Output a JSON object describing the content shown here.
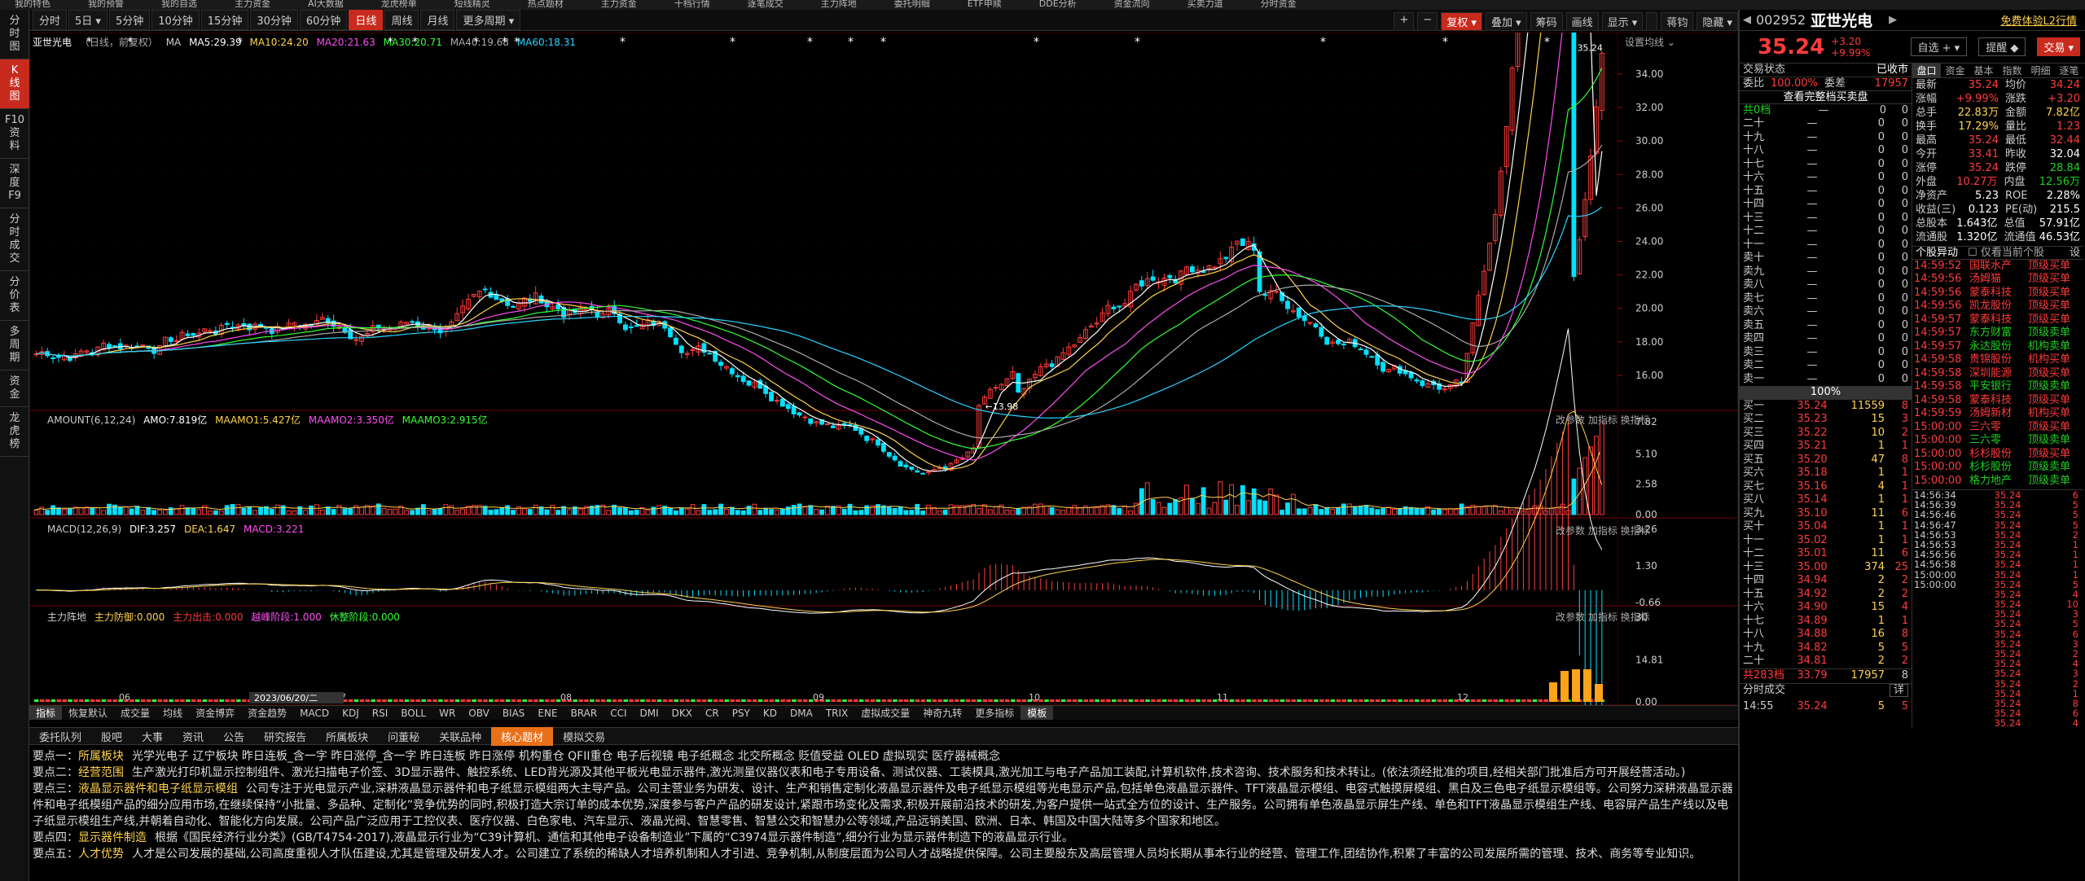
{
  "top_menu": [
    "我的特色",
    "我的预警",
    "我的自选",
    "主力资金",
    "AI大数据",
    "龙虎榜单",
    "短线精灵",
    "热点题材",
    "主力资金",
    "十档行情",
    "逐笔成交",
    "主力阵地",
    "委托明细",
    "ETF申赎",
    "DDE分析",
    "资金流向",
    "买卖力道",
    "分时资金"
  ],
  "left_tabs": [
    {
      "label": "分\n时\n图",
      "active": false
    },
    {
      "label": "K\n线\n图",
      "active": true
    },
    {
      "label": "F10\n资\n料",
      "active": false
    },
    {
      "label": "深\n度\nF9",
      "active": false
    },
    {
      "label": "分\n时\n成\n交",
      "active": false
    },
    {
      "label": "分\n价\n表",
      "active": false
    },
    {
      "label": "多\n周\n期",
      "active": false
    },
    {
      "label": "资\n金",
      "active": false
    },
    {
      "label": "龙\n虎\n榜",
      "active": false
    }
  ],
  "periods": [
    {
      "label": "分时",
      "active": false
    },
    {
      "label": "5日 ▾",
      "active": false
    },
    {
      "label": "5分钟",
      "active": false
    },
    {
      "label": "10分钟",
      "active": false
    },
    {
      "label": "15分钟",
      "active": false
    },
    {
      "label": "30分钟",
      "active": false
    },
    {
      "label": "60分钟",
      "active": false
    },
    {
      "label": "日线",
      "active": true
    },
    {
      "label": "周线",
      "active": false
    },
    {
      "label": "月线",
      "active": false
    },
    {
      "label": "更多周期 ▾",
      "active": false
    }
  ],
  "right_tools": [
    {
      "label": "+",
      "red": false
    },
    {
      "label": "−",
      "red": false
    },
    {
      "label": "复权 ▾",
      "red": true
    },
    {
      "label": "叠加 ▾",
      "red": false
    },
    {
      "label": "筹码",
      "red": false
    },
    {
      "label": "画线",
      "red": false
    },
    {
      "label": "显示 ▾",
      "red": false
    },
    {
      "label": "",
      "red": false
    },
    {
      "label": "蒋钧",
      "red": false
    },
    {
      "label": "隐藏 ▾",
      "red": false
    }
  ],
  "ma_header": {
    "name": "亚世光电",
    "sub": "（日线，前复权）",
    "ma": "MA",
    "ma5": "MA5:29.39",
    "ma10": "MA10:24.20",
    "ma20": "MA20:21.63",
    "ma30": "MA30:20.71",
    "ma40": "MA40:19.68",
    "ma60": "MA60:18.31",
    "right": "设置均线 ⌄"
  },
  "amount_header": {
    "name": "AMOUNT(6,12,24)",
    "amo": "AMO:7.819亿",
    "a1": "MAAMO1:5.427亿",
    "a2": "MAAMO2:3.350亿",
    "a3": "MAAMO3:2.915亿",
    "right": "改参数  加指标  换指标"
  },
  "macd_header": {
    "name": "MACD(12,26,9)",
    "dif": "DIF:3.257",
    "dea": "DEA:1.647",
    "macd": "MACD:3.221",
    "right": "改参数  加指标  换指标"
  },
  "zl_header": {
    "name": "主力阵地",
    "a": "主力防御:0.000",
    "b": "主力出击:0.000",
    "c": "越峰阶段:1.000",
    "d": "休整阶段:0.000",
    "right": "改参数  加指标  换指标"
  },
  "chart_data": {
    "type": "candlestick",
    "price_ticks": [
      "34.00",
      "32.00",
      "30.00",
      "28.00",
      "26.00",
      "24.00",
      "22.00",
      "20.00",
      "18.00",
      "16.00"
    ],
    "price_range": [
      14.2,
      35.6
    ],
    "latest_close_label": "35.24",
    "low_label": "13.98",
    "amount_ticks": [
      "7.82",
      "5.10",
      "2.58",
      "0.00"
    ],
    "macd_ticks": [
      "3.26",
      "1.30",
      "-0.66"
    ],
    "zl_ticks": [
      "30",
      "14.81",
      "0.00"
    ],
    "month_labels": [
      "06",
      "07",
      "08",
      "09",
      "10",
      "11",
      "12"
    ],
    "date_label": "2023/06/20/二"
  },
  "indicator_tabs": [
    {
      "label": "指标",
      "active": true
    },
    {
      "label": "恢复默认",
      "active": false
    },
    {
      "label": "成交量",
      "active": false
    },
    {
      "label": "均线",
      "active": false
    },
    {
      "label": "资金博弈",
      "active": false
    },
    {
      "label": "资金趋势",
      "active": false
    },
    {
      "label": "MACD",
      "active": false
    },
    {
      "label": "KDJ",
      "active": false
    },
    {
      "label": "RSI",
      "active": false
    },
    {
      "label": "BOLL",
      "active": false
    },
    {
      "label": "WR",
      "active": false
    },
    {
      "label": "OBV",
      "active": false
    },
    {
      "label": "BIAS",
      "active": false
    },
    {
      "label": "ENE",
      "active": false
    },
    {
      "label": "BRAR",
      "active": false
    },
    {
      "label": "CCI",
      "active": false
    },
    {
      "label": "DMI",
      "active": false
    },
    {
      "label": "DKX",
      "active": false
    },
    {
      "label": "CR",
      "active": false
    },
    {
      "label": "PSY",
      "active": false
    },
    {
      "label": "KD",
      "active": false
    },
    {
      "label": "DMA",
      "active": false
    },
    {
      "label": "TRIX",
      "active": false
    },
    {
      "label": "虚拟成交量",
      "active": false
    },
    {
      "label": "神奇九转",
      "active": false
    },
    {
      "label": "更多指标",
      "active": false
    },
    {
      "label": "模板",
      "active": true
    }
  ],
  "bottom_tabs": [
    {
      "label": "委托队列",
      "active": false
    },
    {
      "label": "股吧",
      "active": false
    },
    {
      "label": "大事",
      "active": false
    },
    {
      "label": "资讯",
      "active": false
    },
    {
      "label": "公告",
      "active": false
    },
    {
      "label": "研究报告",
      "active": false
    },
    {
      "label": "所属板块",
      "active": false
    },
    {
      "label": "问董秘",
      "active": false
    },
    {
      "label": "关联品种",
      "active": false
    },
    {
      "label": "核心题材",
      "active": true
    },
    {
      "label": "模拟交易",
      "active": false
    }
  ],
  "info_lines": [
    {
      "k": "要点一：",
      "v": "所属板块",
      "t": "光学光电子 辽宁板块 昨日连板_含一字 昨日涨停_含一字 昨日连板 昨日涨停 机构重仓 QFII重仓 电子后视镜 电子纸概念 北交所概念 贬值受益 OLED 虚拟现实 医疗器械概念"
    },
    {
      "k": "要点二：",
      "v": "经营范围",
      "t": "生产激光打印机显示控制组件、激光扫描电子价签、3D显示器件、触控系统、LED背光源及其他平板光电显示器件,激光测量仪器仪表和电子专用设备、测试仪器、工装模具,激光加工与电子产品加工装配,计算机软件,技术咨询、技术服务和技术转让。(依法须经批准的项目,经相关部门批准后方可开展经营活动。)"
    },
    {
      "k": "要点三：",
      "v": "液晶显示器件和电子纸显示模组",
      "t": "公司专注于光电显示产业,深耕液晶显示器件和电子纸显示模组两大主导产品。公司主营业务为研发、设计、生产和销售定制化液晶显示器件及电子纸显示模组等光电显示产品,包括单色液晶显示器件、TFT液晶显示模组、电容式触摸屏模组、黑白及三色电子纸显示模组等。公司努力深耕液晶显示器件和电子纸模组产品的细分应用市场,在继续保持“小批量、多品种、定制化”竞争优势的同时,积极打造大宗订单的成本优势,深度参与客户产品的研发设计,紧跟市场变化及需求,积极开展前沿技术的研发,为客户提供一站式全方位的设计、生产服务。公司拥有单色液晶显示屏生产线、单色和TFT液晶显示模组生产线、电容屏产品生产线以及电子纸显示模组生产线,并朝着自动化、智能化方向发展。公司产品广泛应用于工控仪表、医疗仪器、白色家电、汽车显示、液晶光阀、智慧零售、智慧公交和智慧办公等领域,产品远销美国、欧洲、日本、韩国及中国大陆等多个国家和地区。"
    },
    {
      "k": "要点四：",
      "v": "显示器件制造",
      "t": "根据《国民经济行业分类》(GB/T4754-2017),液晶显示行业为“C39计算机、通信和其他电子设备制造业”下属的“C3974显示器件制造”,细分行业为显示器件制造下的液晶显示行业。"
    },
    {
      "k": "要点五：",
      "v": "人才优势",
      "t": "人才是公司发展的基础,公司高度重视人才队伍建设,尤其是管理及研发人才。公司建立了系统的稀缺人才培养机制和人才引进、竞争机制,从制度层面为公司人才战略提供保障。公司主要股东及高层管理人员均长期从事本行业的经营、管理工作,团结协作,积累了丰富的公司发展所需的管理、技术、商务等专业知识。"
    }
  ],
  "quote": {
    "code": "002952",
    "name": "亚世光电",
    "bonus": "免费体验L2行情",
    "price": "35.24",
    "change": "+3.20",
    "pct": "+9.99%",
    "btn_watch": "自选 + ▾",
    "btn_alert": "提醒 ◆",
    "btn_trade": "交易 ▾",
    "status_label": "交易状态",
    "status": "已收市",
    "wb_label": "委比",
    "wb": "100.00%",
    "wc_label": "委差",
    "wc": "17957",
    "full_btn": "查看完整档买卖盘",
    "depth_header": {
      "label": "共0档",
      "a": "—",
      "b": "0",
      "c": "0"
    },
    "sells": [
      {
        "l": "二十",
        "p": "—",
        "v": "0",
        "n": "0"
      },
      {
        "l": "十九",
        "p": "—",
        "v": "0",
        "n": "0"
      },
      {
        "l": "十八",
        "p": "—",
        "v": "0",
        "n": "0"
      },
      {
        "l": "十七",
        "p": "—",
        "v": "0",
        "n": "0"
      },
      {
        "l": "十六",
        "p": "—",
        "v": "0",
        "n": "0"
      },
      {
        "l": "十五",
        "p": "—",
        "v": "0",
        "n": "0"
      },
      {
        "l": "十四",
        "p": "—",
        "v": "0",
        "n": "0"
      },
      {
        "l": "十三",
        "p": "—",
        "v": "0",
        "n": "0"
      },
      {
        "l": "十二",
        "p": "—",
        "v": "0",
        "n": "0"
      },
      {
        "l": "十一",
        "p": "—",
        "v": "0",
        "n": "0"
      },
      {
        "l": "卖十",
        "p": "—",
        "v": "0",
        "n": "0"
      },
      {
        "l": "卖九",
        "p": "—",
        "v": "0",
        "n": "0"
      },
      {
        "l": "卖八",
        "p": "—",
        "v": "0",
        "n": "0"
      },
      {
        "l": "卖七",
        "p": "—",
        "v": "0",
        "n": "0"
      },
      {
        "l": "卖六",
        "p": "—",
        "v": "0",
        "n": "0"
      },
      {
        "l": "卖五",
        "p": "—",
        "v": "0",
        "n": "0"
      },
      {
        "l": "卖四",
        "p": "—",
        "v": "0",
        "n": "0"
      },
      {
        "l": "卖三",
        "p": "—",
        "v": "0",
        "n": "0"
      },
      {
        "l": "卖二",
        "p": "—",
        "v": "0",
        "n": "0"
      },
      {
        "l": "卖一",
        "p": "—",
        "v": "0",
        "n": "0"
      }
    ],
    "mid_pct": "100%",
    "buys": [
      {
        "l": "买一",
        "p": "35.24",
        "v": "11559",
        "n": "8"
      },
      {
        "l": "买二",
        "p": "35.23",
        "v": "15",
        "n": "3"
      },
      {
        "l": "买三",
        "p": "35.22",
        "v": "10",
        "n": "2"
      },
      {
        "l": "买四",
        "p": "35.21",
        "v": "1",
        "n": "1"
      },
      {
        "l": "买五",
        "p": "35.20",
        "v": "47",
        "n": "8"
      },
      {
        "l": "买六",
        "p": "35.18",
        "v": "1",
        "n": "1"
      },
      {
        "l": "买七",
        "p": "35.16",
        "v": "4",
        "n": "1"
      },
      {
        "l": "买八",
        "p": "35.14",
        "v": "1",
        "n": "1"
      },
      {
        "l": "买九",
        "p": "35.10",
        "v": "11",
        "n": "6"
      },
      {
        "l": "买十",
        "p": "35.04",
        "v": "1",
        "n": "1"
      },
      {
        "l": "十一",
        "p": "35.02",
        "v": "1",
        "n": "1"
      },
      {
        "l": "十二",
        "p": "35.01",
        "v": "11",
        "n": "6"
      },
      {
        "l": "十三",
        "p": "35.00",
        "v": "374",
        "n": "25"
      },
      {
        "l": "十四",
        "p": "34.94",
        "v": "2",
        "n": "2"
      },
      {
        "l": "十五",
        "p": "34.92",
        "v": "2",
        "n": "2"
      },
      {
        "l": "十六",
        "p": "34.90",
        "v": "15",
        "n": "4"
      },
      {
        "l": "十七",
        "p": "34.89",
        "v": "1",
        "n": "1"
      },
      {
        "l": "十八",
        "p": "34.88",
        "v": "16",
        "n": "8"
      },
      {
        "l": "十九",
        "p": "34.82",
        "v": "5",
        "n": "5"
      },
      {
        "l": "二十",
        "p": "34.81",
        "v": "2",
        "n": "2"
      }
    ],
    "buy_total": {
      "label": "共283档",
      "p": "33.79",
      "v": "17957",
      "n": "8"
    },
    "fsc_label": "分时成交",
    "fsc_btn": "详",
    "fsc_last": {
      "t": "14:55",
      "p": "35.24",
      "v": "5",
      "n": "5"
    }
  },
  "stats_tabs": [
    {
      "label": "盘口",
      "active": true
    },
    {
      "label": "资金",
      "active": false
    },
    {
      "label": "基本",
      "active": false
    },
    {
      "label": "指数",
      "active": false
    },
    {
      "label": "明细",
      "active": false
    },
    {
      "label": "逐笔",
      "active": false
    }
  ],
  "stats": [
    {
      "a": "最新",
      "av": "35.24",
      "ac": "red",
      "b": "均价",
      "bv": "34.24",
      "bc": "red"
    },
    {
      "a": "涨幅",
      "av": "+9.99%",
      "ac": "red",
      "b": "涨跌",
      "bv": "+3.20",
      "bc": "red"
    },
    {
      "a": "总手",
      "av": "22.83万",
      "ac": "yel",
      "b": "金额",
      "bv": "7.82亿",
      "bc": "yel"
    },
    {
      "a": "换手",
      "av": "17.29%",
      "ac": "yel",
      "b": "量比",
      "bv": "1.23",
      "bc": "red"
    },
    {
      "a": "最高",
      "av": "35.24",
      "ac": "red",
      "b": "最低",
      "bv": "32.44",
      "bc": "red"
    },
    {
      "a": "今开",
      "av": "33.41",
      "ac": "red",
      "b": "昨收",
      "bv": "32.04",
      "bc": "wht"
    },
    {
      "a": "涨停",
      "av": "35.24",
      "ac": "red",
      "b": "跌停",
      "bv": "28.84",
      "bc": "grn"
    },
    {
      "a": "外盘",
      "av": "10.27万",
      "ac": "red",
      "b": "内盘",
      "bv": "12.56万",
      "bc": "grn"
    },
    {
      "a": "净资产",
      "av": "5.23",
      "ac": "wht",
      "b": "ROE",
      "bv": "2.28%",
      "bc": "wht"
    },
    {
      "a": "收益(三)",
      "av": "0.123",
      "ac": "wht",
      "b": "PE(动)",
      "bv": "215.5",
      "bc": "wht"
    },
    {
      "a": "总股本",
      "av": "1.643亿",
      "ac": "wht",
      "b": "总值",
      "bv": "57.91亿",
      "bc": "wht"
    },
    {
      "a": "流通股",
      "av": "1.320亿",
      "ac": "wht",
      "b": "流通值",
      "bv": "46.53亿",
      "bc": "wht"
    }
  ],
  "yd_header": {
    "title": "个股异动",
    "check": "仅看当前个股",
    "btn": "设"
  },
  "movers": [
    {
      "t": "14:59:52",
      "n": "国联水产",
      "e": "顶级买单",
      "c": "red"
    },
    {
      "t": "14:59:56",
      "n": "汤姆猫",
      "e": "顶级买单",
      "c": "red"
    },
    {
      "t": "14:59:56",
      "n": "蒙泰科技",
      "e": "顶级买单",
      "c": "red"
    },
    {
      "t": "14:59:56",
      "n": "凯龙股份",
      "e": "顶级买单",
      "c": "red"
    },
    {
      "t": "14:59:57",
      "n": "蒙泰科技",
      "e": "顶级买单",
      "c": "red"
    },
    {
      "t": "14:59:57",
      "n": "东方财富",
      "e": "顶级卖单",
      "c": "grn"
    },
    {
      "t": "14:59:57",
      "n": "永达股份",
      "e": "机构卖单",
      "c": "grn"
    },
    {
      "t": "14:59:58",
      "n": "贵锦股份",
      "e": "机构买单",
      "c": "red"
    },
    {
      "t": "14:59:58",
      "n": "深圳能源",
      "e": "顶级买单",
      "c": "red"
    },
    {
      "t": "14:59:58",
      "n": "平安银行",
      "e": "顶级卖单",
      "c": "grn"
    },
    {
      "t": "14:59:58",
      "n": "蒙泰科技",
      "e": "顶级买单",
      "c": "red"
    },
    {
      "t": "14:59:59",
      "n": "汤姆新材",
      "e": "机构买单",
      "c": "red"
    },
    {
      "t": "15:00:00",
      "n": "三六零",
      "e": "顶级买单",
      "c": "red"
    },
    {
      "t": "15:00:00",
      "n": "三六零",
      "e": "顶级卖单",
      "c": "grn"
    },
    {
      "t": "15:00:00",
      "n": "杉杉股份",
      "e": "顶级买单",
      "c": "red"
    },
    {
      "t": "15:00:00",
      "n": "杉杉股份",
      "e": "顶级卖单",
      "c": "grn"
    },
    {
      "t": "15:00:00",
      "n": "格力地产",
      "e": "顶级卖单",
      "c": "grn"
    }
  ],
  "ticks": [
    {
      "t": "14:56:34",
      "p": "35.24",
      "v": "6"
    },
    {
      "t": "14:56:39",
      "p": "35.24",
      "v": "5"
    },
    {
      "t": "14:56:46",
      "p": "35.24",
      "v": "5"
    },
    {
      "t": "14:56:47",
      "p": "35.24",
      "v": "5"
    },
    {
      "t": "14:56:53",
      "p": "35.24",
      "v": "2"
    },
    {
      "t": "14:56:53",
      "p": "35.24",
      "v": "1"
    },
    {
      "t": "14:56:56",
      "p": "35.24",
      "v": "1"
    },
    {
      "t": "14:56:58",
      "p": "35.24",
      "v": "1"
    },
    {
      "t": "15:00:00",
      "p": "35.24",
      "v": "1"
    },
    {
      "t": "15:00:00",
      "p": "35.24",
      "v": "5"
    },
    {
      "t": "",
      "p": "35.24",
      "v": "4"
    },
    {
      "t": "",
      "p": "35.24",
      "v": "10"
    },
    {
      "t": "",
      "p": "35.24",
      "v": "3"
    },
    {
      "t": "",
      "p": "35.24",
      "v": "5"
    },
    {
      "t": "",
      "p": "35.24",
      "v": "6"
    },
    {
      "t": "",
      "p": "35.24",
      "v": "3"
    },
    {
      "t": "",
      "p": "35.24",
      "v": "2"
    },
    {
      "t": "",
      "p": "35.24",
      "v": "4"
    },
    {
      "t": "",
      "p": "35.24",
      "v": "3"
    },
    {
      "t": "",
      "p": "35.24",
      "v": "2"
    },
    {
      "t": "",
      "p": "35.24",
      "v": "1"
    },
    {
      "t": "",
      "p": "35.24",
      "v": "8"
    },
    {
      "t": "",
      "p": "35.24",
      "v": "6"
    },
    {
      "t": "",
      "p": "35.24",
      "v": "4"
    }
  ],
  "colors": {
    "up": "#ff3b3b",
    "down": "#00e0ff",
    "ma5": "#ffffff",
    "ma10": "#ffd24d",
    "ma20": "#ff4df2",
    "ma30": "#33ff33",
    "ma40": "#aaaaaa",
    "ma60": "#2ad4ff",
    "accent": "#c92a1e"
  }
}
